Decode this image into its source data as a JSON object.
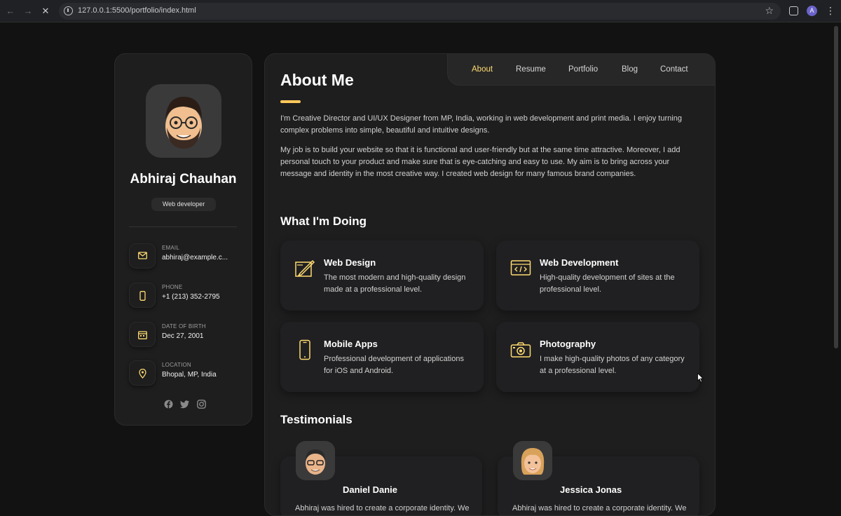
{
  "browser": {
    "url": "127.0.0.1:5500/portfolio/index.html",
    "profile_initial": "A"
  },
  "sidebar": {
    "name": "Abhiraj Chauhan",
    "title": "Web developer",
    "contacts": [
      {
        "label": "EMAIL",
        "value": "abhiraj@example.c...",
        "icon": "mail-icon"
      },
      {
        "label": "PHONE",
        "value": "+1 (213) 352-2795",
        "icon": "phone-icon"
      },
      {
        "label": "DATE OF BIRTH",
        "value": "Dec 27, 2001",
        "icon": "calendar-icon"
      },
      {
        "label": "LOCATION",
        "value": "Bhopal, MP, India",
        "icon": "location-icon"
      }
    ],
    "socials": [
      "facebook-icon",
      "twitter-icon",
      "instagram-icon"
    ]
  },
  "navbar": {
    "items": [
      "About",
      "Resume",
      "Portfolio",
      "Blog",
      "Contact"
    ],
    "active": "About"
  },
  "about": {
    "heading": "About Me",
    "paragraphs": [
      "I'm Creative Director and UI/UX Designer from MP, India, working in web development and print media. I enjoy turning complex problems into simple, beautiful and intuitive designs.",
      "My job is to build your website so that it is functional and user-friendly but at the same time attractive. Moreover, I add personal touch to your product and make sure that is eye-catching and easy to use. My aim is to bring across your message and identity in the most creative way. I created web design for many famous brand companies."
    ]
  },
  "services": {
    "heading": "What I'm Doing",
    "items": [
      {
        "title": "Web Design",
        "text": "The most modern and high-quality design made at a professional level.",
        "icon": "design-icon"
      },
      {
        "title": "Web Development",
        "text": "High-quality development of sites at the professional level.",
        "icon": "code-icon"
      },
      {
        "title": "Mobile Apps",
        "text": "Professional development of applications for iOS and Android.",
        "icon": "mobile-icon"
      },
      {
        "title": "Photography",
        "text": "I make high-quality photos of any category at a professional level.",
        "icon": "camera-icon"
      }
    ]
  },
  "testimonials": {
    "heading": "Testimonials",
    "items": [
      {
        "name": "Daniel Danie",
        "text": "Abhiraj was hired to create a corporate identity. We were very pleased with the work"
      },
      {
        "name": "Jessica Jonas",
        "text": "Abhiraj was hired to create a corporate identity. We were very pleased with the work"
      }
    ]
  },
  "colors": {
    "accent": "#ffdb70",
    "background": "#121212",
    "card": "#1e1e1f"
  }
}
